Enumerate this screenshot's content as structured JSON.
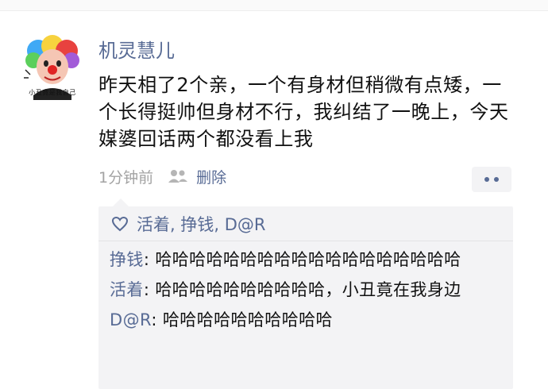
{
  "post": {
    "username": "机灵慧儿",
    "avatar_caption": "小丑竟是我自己",
    "content": "昨天相了2个亲，一个有身材但稍微有点矮，一个长得挺帅但身材不行，我纠结了一晚上，今天媒婆回话两个都没看上我",
    "timestamp": "1分钟前",
    "delete_label": "删除",
    "visibility_icon": "people-icon",
    "more_icon": "more-dots-icon"
  },
  "likes": {
    "icon": "heart-icon",
    "names": "活着, 挣钱, D@R"
  },
  "comments": [
    {
      "author": "挣钱",
      "separator": ": ",
      "text": "哈哈哈哈哈哈哈哈哈哈哈哈哈哈哈哈哈哈"
    },
    {
      "author": "活着",
      "separator": ": ",
      "text": "哈哈哈哈哈哈哈哈哈哈，小丑竟在我身边"
    },
    {
      "author": "D@R",
      "separator": ": ",
      "text": "哈哈哈哈哈哈哈哈哈哈"
    }
  ],
  "colors": {
    "link_blue": "#586b95",
    "text": "#111111",
    "muted": "#a3a3a3",
    "comment_bg": "#f3f3f5"
  }
}
